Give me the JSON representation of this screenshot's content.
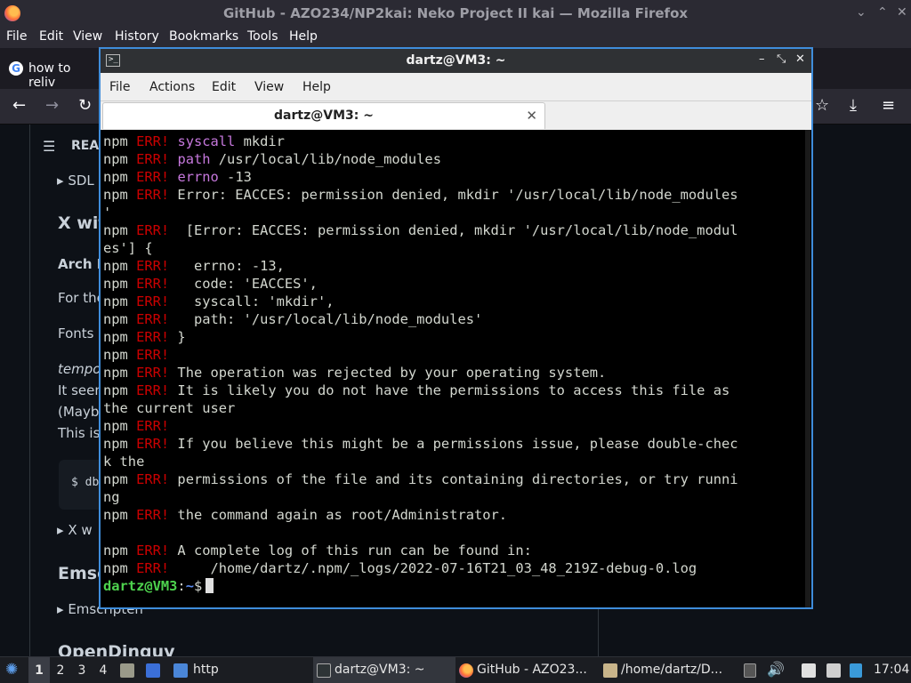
{
  "firefox": {
    "window_title": "GitHub - AZO234/NP2kai: Neko Project II kai — Mozilla Firefox",
    "window_controls": [
      "⌄",
      "⌃",
      "✕"
    ],
    "menu": [
      "File",
      "Edit",
      "View",
      "History",
      "Bookmarks",
      "Tools",
      "Help"
    ],
    "tab_label": "how to reliv",
    "tab_icon": "G",
    "nav": {
      "back": "←",
      "forward": "→",
      "reload": "↻",
      "bookmark_star": "☆",
      "downloads": "⤓",
      "menu": "≡"
    }
  },
  "page": {
    "outline_label": "REA",
    "items": [
      {
        "name": "sdl-item",
        "text": "SDL"
      },
      {
        "name": "x-heading",
        "text": "X wit"
      },
      {
        "name": "arch-heading",
        "text": "Arch L"
      },
      {
        "name": "for-the-text",
        "text": "For the"
      },
      {
        "name": "fonts-text",
        "text": "Fonts"
      },
      {
        "name": "tempo-text",
        "text": "tempo"
      },
      {
        "name": "it-seem-text",
        "text": "It seem"
      },
      {
        "name": "mayb-text",
        "text": "(Mayb"
      },
      {
        "name": "this-is-text",
        "text": "This is"
      },
      {
        "name": "code-text",
        "text": "$ db"
      },
      {
        "name": "x-w-item",
        "text": "X w"
      },
      {
        "name": "emsc-heading",
        "text": "Emsc"
      },
      {
        "name": "emscripten-item",
        "text": "Emscripten"
      },
      {
        "name": "opendingux-heading",
        "text": "OpenDinguv"
      }
    ]
  },
  "terminal": {
    "window_title": "dartz@VM3: ~",
    "title_icon": ">_",
    "controls": [
      "–",
      "⤡",
      "✕"
    ],
    "menu": [
      "File",
      "Actions",
      "Edit",
      "View",
      "Help"
    ],
    "tab_label": "dartz@VM3: ~",
    "tab_close": "✕",
    "lines": [
      {
        "a": "npm ",
        "b": "ERR!",
        "c": " ",
        "k": "syscall",
        "d": " mkdir"
      },
      {
        "a": "npm ",
        "b": "ERR!",
        "c": " ",
        "k": "path",
        "d": " /usr/local/lib/node_modules"
      },
      {
        "a": "npm ",
        "b": "ERR!",
        "c": " ",
        "k": "errno",
        "d": " -13"
      },
      {
        "a": "npm ",
        "b": "ERR!",
        "c": " Error: EACCES: permission denied, mkdir '/usr/local/lib/node_modules",
        "k": "",
        "d": ""
      },
      {
        "a": "'",
        "b": "",
        "c": "",
        "k": "",
        "d": ""
      },
      {
        "a": "npm ",
        "b": "ERR!",
        "c": "  [Error: EACCES: permission denied, mkdir '/usr/local/lib/node_modul",
        "k": "",
        "d": ""
      },
      {
        "a": "es'] {",
        "b": "",
        "c": "",
        "k": "",
        "d": ""
      },
      {
        "a": "npm ",
        "b": "ERR!",
        "c": "   errno: -13,",
        "k": "",
        "d": ""
      },
      {
        "a": "npm ",
        "b": "ERR!",
        "c": "   code: 'EACCES',",
        "k": "",
        "d": ""
      },
      {
        "a": "npm ",
        "b": "ERR!",
        "c": "   syscall: 'mkdir',",
        "k": "",
        "d": ""
      },
      {
        "a": "npm ",
        "b": "ERR!",
        "c": "   path: '/usr/local/lib/node_modules'",
        "k": "",
        "d": ""
      },
      {
        "a": "npm ",
        "b": "ERR!",
        "c": " }",
        "k": "",
        "d": ""
      },
      {
        "a": "npm ",
        "b": "ERR!",
        "c": "",
        "k": "",
        "d": ""
      },
      {
        "a": "npm ",
        "b": "ERR!",
        "c": " The operation was rejected by your operating system.",
        "k": "",
        "d": ""
      },
      {
        "a": "npm ",
        "b": "ERR!",
        "c": " It is likely you do not have the permissions to access this file as",
        "k": "",
        "d": ""
      },
      {
        "a": "the current user",
        "b": "",
        "c": "",
        "k": "",
        "d": ""
      },
      {
        "a": "npm ",
        "b": "ERR!",
        "c": "",
        "k": "",
        "d": ""
      },
      {
        "a": "npm ",
        "b": "ERR!",
        "c": " If you believe this might be a permissions issue, please double-chec",
        "k": "",
        "d": ""
      },
      {
        "a": "k the",
        "b": "",
        "c": "",
        "k": "",
        "d": ""
      },
      {
        "a": "npm ",
        "b": "ERR!",
        "c": " permissions of the file and its containing directories, or try runni",
        "k": "",
        "d": ""
      },
      {
        "a": "ng",
        "b": "",
        "c": "",
        "k": "",
        "d": ""
      },
      {
        "a": "npm ",
        "b": "ERR!",
        "c": " the command again as root/Administrator.",
        "k": "",
        "d": ""
      },
      {
        "a": "",
        "b": "",
        "c": "",
        "k": "",
        "d": ""
      },
      {
        "a": "npm ",
        "b": "ERR!",
        "c": " A complete log of this run can be found in:",
        "k": "",
        "d": ""
      },
      {
        "a": "npm ",
        "b": "ERR!",
        "c": "     /home/dartz/.npm/_logs/2022-07-16T21_03_48_219Z-debug-0.log",
        "k": "",
        "d": ""
      }
    ],
    "prompt": {
      "user": "dartz@VM3",
      "sep": ":",
      "path": "~",
      "sign": "$"
    }
  },
  "taskbar": {
    "start_icon": "start-menu-icon",
    "workspaces": [
      "1",
      "2",
      "3",
      "4"
    ],
    "launcher_folder": "http",
    "tasks": [
      {
        "name": "task-terminal",
        "label": "dartz@VM3: ~"
      },
      {
        "name": "task-firefox",
        "label": "GitHub - AZO23..."
      },
      {
        "name": "task-files",
        "label": "/home/dartz/D..."
      }
    ],
    "clock": "17:04"
  },
  "colors": {
    "terminal_bg": "#000000",
    "err_red": "#cc0000",
    "key_purple": "#c678dd",
    "prompt_green": "#4ed34e",
    "prompt_blue": "#5b8cf0",
    "window_focus_border": "#3f8ddb"
  }
}
